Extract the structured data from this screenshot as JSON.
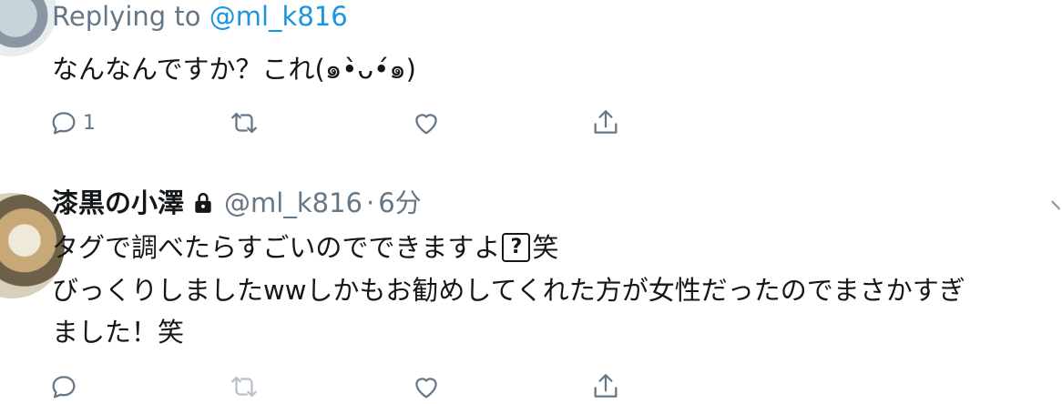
{
  "tweet1": {
    "reply_prefix": "Replying to ",
    "reply_handle": "@ml_k816",
    "text": "なんなんですか？これ(๑•̀ᴗ•́๑)",
    "reply_count": "1"
  },
  "tweet2": {
    "display_name": "漆黒の小澤",
    "handle": "@ml_k816",
    "separator": "·",
    "time": "6分",
    "line1_before": "タグで調べたらすごいのでできますよ",
    "line1_box": "?",
    "line1_after": "笑",
    "line2": "びっくりしましたwwしかもお勧めしてくれた方が女性だったのでまさかすぎ",
    "line3": "ました！笑"
  },
  "icons": [
    "reply-icon",
    "retweet-icon",
    "like-icon",
    "share-icon",
    "lock-icon",
    "chevron-down-icon"
  ],
  "colors": {
    "muted": "#657786",
    "link": "#1b95e0",
    "text": "#14171a"
  }
}
